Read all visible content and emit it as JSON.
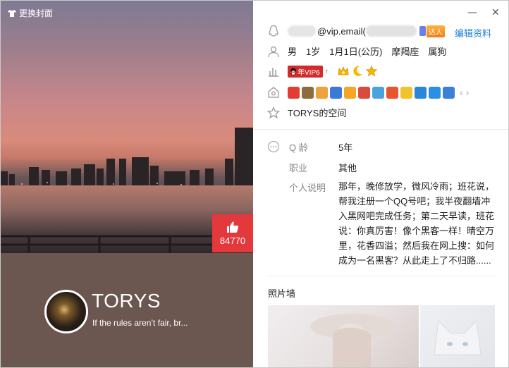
{
  "header": {
    "change_cover_label": "更换封面"
  },
  "profile": {
    "nickname": "TORYS",
    "signature": "If the rules aren’t fair, br...",
    "likes_count": "84770"
  },
  "contact": {
    "email_suffix": "@vip.email(",
    "daren_tag": "达人",
    "edit_label": "编辑资料"
  },
  "basic_info": [
    "男",
    "1岁",
    "1月1日(公历)",
    "摩羯座",
    "属狗"
  ],
  "vip": {
    "badge_label": "年VIP6",
    "arrow": "↑"
  },
  "space": {
    "label": "TORYS的空间"
  },
  "details": {
    "qage_label": "Q 龄",
    "qage_value": "5年",
    "job_label": "职业",
    "job_value": "其他",
    "bio_label": "个人说明",
    "bio_value": "那年，晚修放学，微风冷雨；班花说，帮我注册一个QQ号吧；我半夜翻墙冲入黑网吧完成任务；第二天早读，班花说：你真厉害！像个黑客一样！晴空万里，花香四溢；然后我在网上搜：如何成为一名黑客？从此走上了不归路......"
  },
  "photo_wall": {
    "title": "照片墙"
  },
  "window_controls": {
    "minimize": "—",
    "close": "✕"
  },
  "nav": {
    "prev": "‹",
    "next": "›"
  },
  "colors": {
    "accent_blue": "#1b7ed0",
    "like_red": "#e4393c",
    "band_brown": "#6b5650",
    "vip_red": "#d22b2b"
  }
}
